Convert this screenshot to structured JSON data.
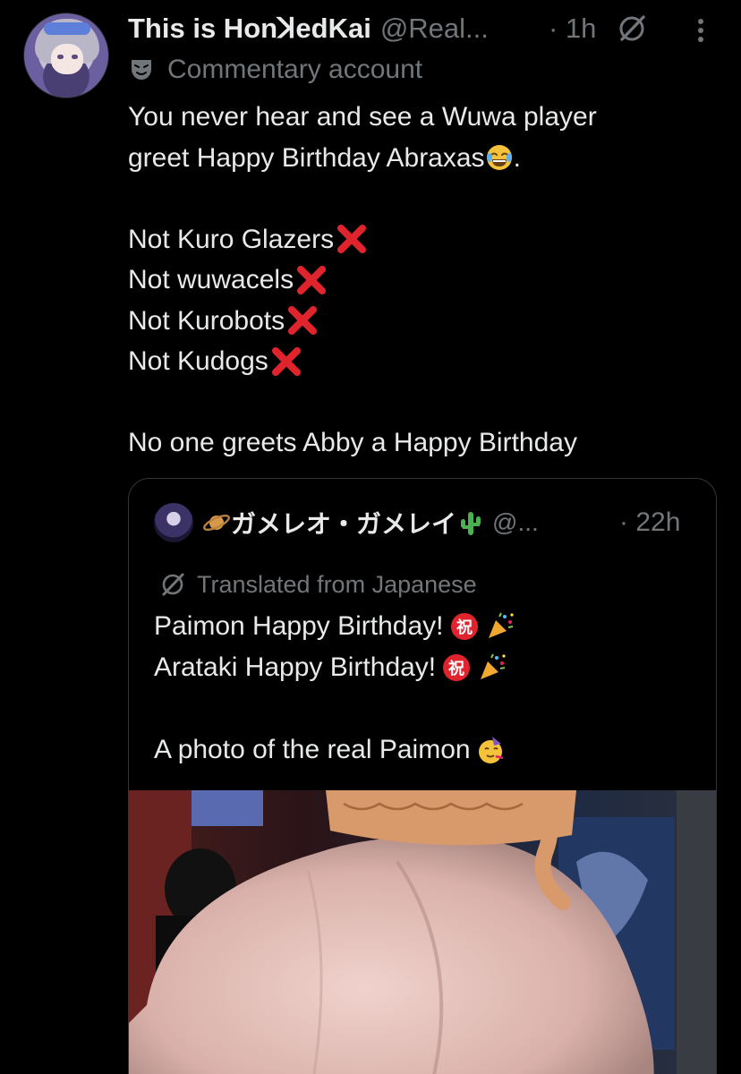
{
  "tweet": {
    "display_name": "This is HonꓘedKai",
    "handle": "@Real...",
    "time": "· 1h",
    "label": "Commentary account",
    "lines": [
      "You never hear and see a Wuwa player",
      "greet Happy Birthday Abraxas",
      "",
      "Not Kuro Glazers",
      "Not wuwacels",
      "Not Kurobots",
      "Not Kudogs",
      "",
      "No one greets Abby a Happy Birthday"
    ],
    "line2_suffix": "."
  },
  "quote": {
    "display_name": "ガメレオ・ガメレイ",
    "handle": "@...",
    "time": "· 22h",
    "translated_label": "Translated from Japanese",
    "lines": [
      "Paimon Happy Birthday!",
      "Arataki Happy Birthday!",
      "",
      "A photo of the real Paimon"
    ]
  },
  "icons": {
    "grok": "grok-icon",
    "more": "more-vertical-icon",
    "commentary": "theater-mask-icon",
    "cross": "cross-mark-emoji",
    "laugh": "joy-emoji",
    "celebrate_kanji": "congratulations-kanji-emoji",
    "popper": "party-popper-emoji",
    "party_face": "partying-face-emoji",
    "planet": "ringed-planet-emoji",
    "cactus": "cactus-emoji"
  },
  "colors": {
    "background": "#000000",
    "text": "#e7e9ea",
    "muted": "#71767b",
    "border": "#333639",
    "cross": "#e0242e"
  }
}
